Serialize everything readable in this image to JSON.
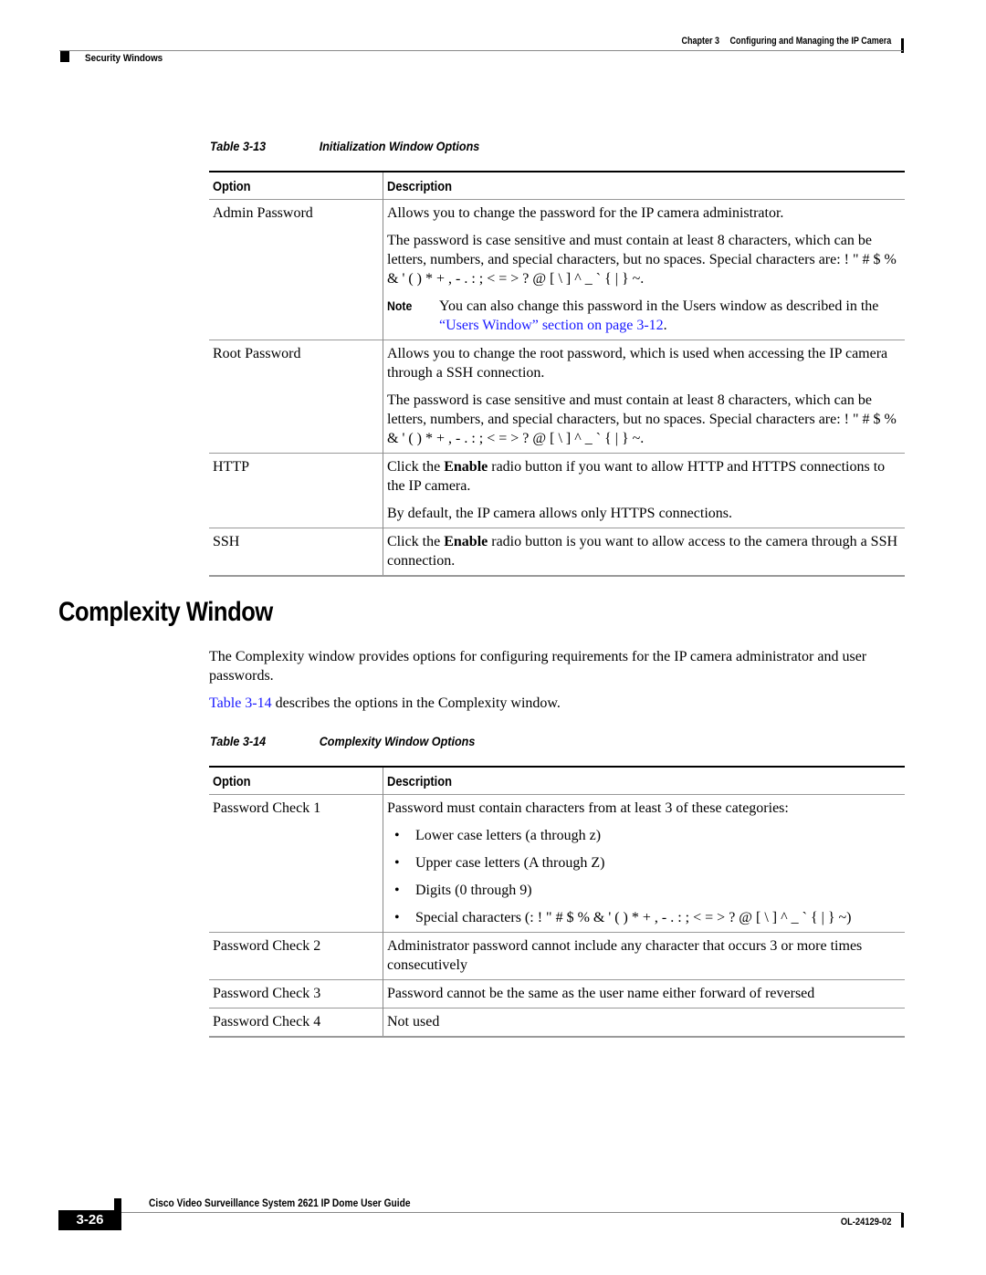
{
  "header": {
    "chapter_num": "Chapter 3",
    "chapter_title": "Configuring and Managing the IP Camera",
    "section": "Security Windows"
  },
  "table1": {
    "number": "Table 3-13",
    "title": "Initialization Window Options",
    "col_option": "Option",
    "col_description": "Description",
    "rows": [
      {
        "option": "Admin Password",
        "p1": "Allows you to change the password for the IP camera administrator.",
        "p2": "The password is case sensitive and must contain at least 8 characters, which can be letters, numbers, and special characters, but no spaces. Special characters are: ! \" # $ % & ' ( ) * + , - . : ; < = > ? @ [ \\ ] ^ _ ` { | } ~.",
        "note_label": "Note",
        "note_text": "You can also change this password in the Users window as described in the ",
        "note_link": "“Users Window” section on page 3-12",
        "note_end": "."
      },
      {
        "option": "Root Password",
        "p1": "Allows you to change the root password, which is used when accessing the IP camera through a SSH connection.",
        "p2": "The password is case sensitive and must contain at least 8 characters, which can be letters, numbers, and special characters, but no spaces. Special characters are: ! \" # $ % & ' ( ) * + , - . : ; < = > ? @ [ \\ ] ^ _ ` { | } ~."
      },
      {
        "option": "HTTP",
        "p1_pre": "Click the ",
        "p1_bold": "Enable",
        "p1_post": " radio button if you want to allow HTTP and HTTPS connections to the IP camera.",
        "p2": "By default, the IP camera allows only HTTPS connections."
      },
      {
        "option": "SSH",
        "p1_pre": "Click the ",
        "p1_bold": "Enable",
        "p1_post": " radio button is you want to allow access to the camera through a SSH connection."
      }
    ]
  },
  "section": {
    "heading": "Complexity Window",
    "intro": "The Complexity window provides options for configuring requirements for the IP camera administrator and user passwords.",
    "ref_link": "Table 3-14",
    "ref_text": " describes the options in the Complexity window."
  },
  "table2": {
    "number": "Table 3-14",
    "title": "Complexity Window Options",
    "col_option": "Option",
    "col_description": "Description",
    "bullet_glyph": "•",
    "rows": [
      {
        "option": "Password Check 1",
        "p1": "Password must contain characters from at least 3 of these categories:",
        "bullets": [
          "Lower case letters (a through z)",
          "Upper case letters (A through Z)",
          "Digits (0 through 9)",
          "Special characters (: ! \" # $ % & ' ( ) * + , - . : ; < = > ? @ [ \\ ] ^ _ ` { | } ~)"
        ]
      },
      {
        "option": "Password Check 2",
        "p1": "Administrator password cannot include any character that occurs 3 or more times consecutively"
      },
      {
        "option": "Password Check 3",
        "p1": "Password cannot be the same as the user name either forward of reversed"
      },
      {
        "option": "Password Check 4",
        "p1": "Not used"
      }
    ]
  },
  "footer": {
    "guide_title": "Cisco Video Surveillance System 2621 IP Dome User Guide",
    "page_number": "3-26",
    "doc_number": "OL-24129-02"
  },
  "colors": {
    "link": "#1a1aff",
    "text": "#000000",
    "rule": "#888888"
  }
}
